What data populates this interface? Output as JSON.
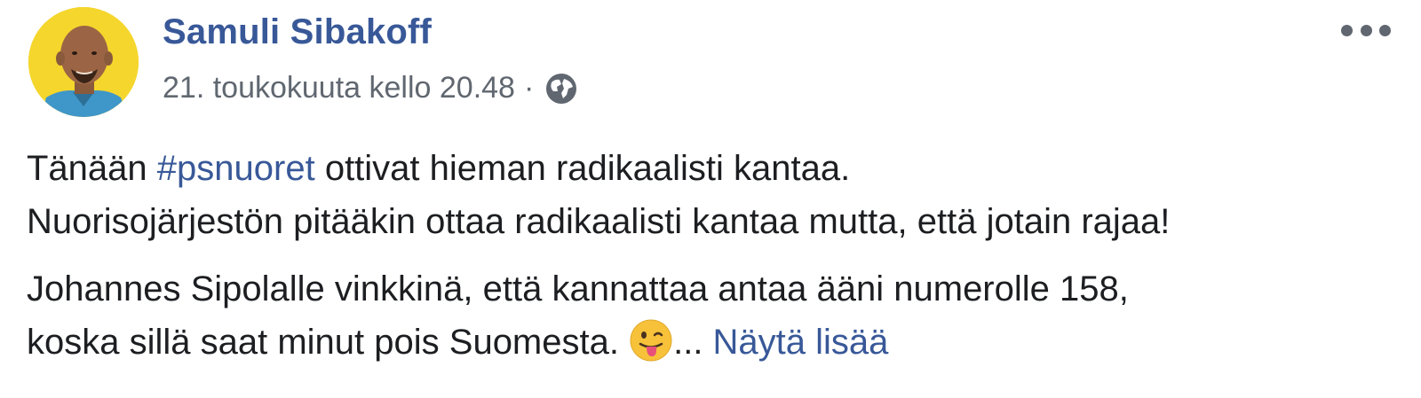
{
  "post": {
    "author": "Samuli Sibakoff",
    "timestamp": "21. toukokuuta kello 20.48",
    "separator": "·",
    "privacy_icon": "globe-icon",
    "more_icon": "more-options-icon",
    "avatar_icon": "profile-photo",
    "paragraph1": {
      "prefix": "Tänään ",
      "hashtag": "#psnuoret",
      "suffix": " ottivat hieman radikaalisti kantaa.",
      "line2": "Nuorisojärjestön pitääkin ottaa radikaalisti kantaa mutta, että jotain rajaa!"
    },
    "paragraph2": {
      "line1": "Johannes Sipolalle vinkkinä, että kannattaa antaa ääni numerolle 158,",
      "line2": "koska sillä saat minut pois Suomesta. ",
      "emoji_icon": "winking-face-with-tongue-icon",
      "ellipsis": "... ",
      "see_more": "Näytä lisää"
    }
  },
  "colors": {
    "link": "#385898",
    "meta": "#606770",
    "text": "#1c1e21",
    "avatar_bg": "#f5d62c"
  }
}
